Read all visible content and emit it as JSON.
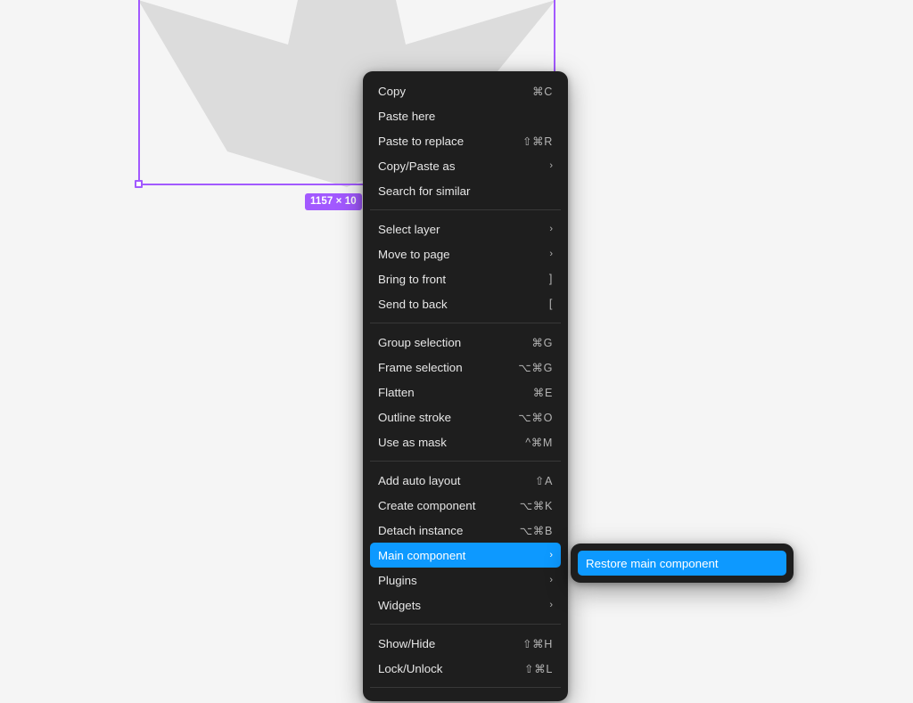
{
  "canvas": {
    "background_color": "#f5f5f5",
    "shape_name": "star",
    "shape_color": "#dcdcdc",
    "selection_color": "#a259ff",
    "size_badge": "1157 × 10"
  },
  "context_menu": {
    "background_color": "#1e1e1e",
    "highlight_color": "#0d99ff",
    "groups": [
      {
        "items": [
          {
            "label": "Copy",
            "shortcut": "⌘C",
            "chevron": ""
          },
          {
            "label": "Paste here",
            "shortcut": "",
            "chevron": ""
          },
          {
            "label": "Paste to replace",
            "shortcut": "⇧⌘R",
            "chevron": ""
          },
          {
            "label": "Copy/Paste as",
            "shortcut": "",
            "chevron": "›"
          },
          {
            "label": "Search for similar",
            "shortcut": "",
            "chevron": ""
          }
        ]
      },
      {
        "items": [
          {
            "label": "Select layer",
            "shortcut": "",
            "chevron": "›"
          },
          {
            "label": "Move to page",
            "shortcut": "",
            "chevron": "›"
          },
          {
            "label": "Bring to front",
            "shortcut": "]",
            "chevron": ""
          },
          {
            "label": "Send to back",
            "shortcut": "[",
            "chevron": ""
          }
        ]
      },
      {
        "items": [
          {
            "label": "Group selection",
            "shortcut": "⌘G",
            "chevron": ""
          },
          {
            "label": "Frame selection",
            "shortcut": "⌥⌘G",
            "chevron": ""
          },
          {
            "label": "Flatten",
            "shortcut": "⌘E",
            "chevron": ""
          },
          {
            "label": "Outline stroke",
            "shortcut": "⌥⌘O",
            "chevron": ""
          },
          {
            "label": "Use as mask",
            "shortcut": "^⌘M",
            "chevron": ""
          }
        ]
      },
      {
        "items": [
          {
            "label": "Add auto layout",
            "shortcut": "⇧A",
            "chevron": ""
          },
          {
            "label": "Create component",
            "shortcut": "⌥⌘K",
            "chevron": ""
          },
          {
            "label": "Detach instance",
            "shortcut": "⌥⌘B",
            "chevron": ""
          },
          {
            "label": "Main component",
            "shortcut": "",
            "chevron": "›",
            "selected": true
          },
          {
            "label": "Plugins",
            "shortcut": "",
            "chevron": "›"
          },
          {
            "label": "Widgets",
            "shortcut": "",
            "chevron": "›"
          }
        ]
      },
      {
        "items": [
          {
            "label": "Show/Hide",
            "shortcut": "⇧⌘H",
            "chevron": ""
          },
          {
            "label": "Lock/Unlock",
            "shortcut": "⇧⌘L",
            "chevron": ""
          }
        ]
      }
    ]
  },
  "submenu": {
    "items": [
      {
        "label": "Restore main component",
        "shortcut": "",
        "chevron": "",
        "selected": true
      }
    ]
  }
}
